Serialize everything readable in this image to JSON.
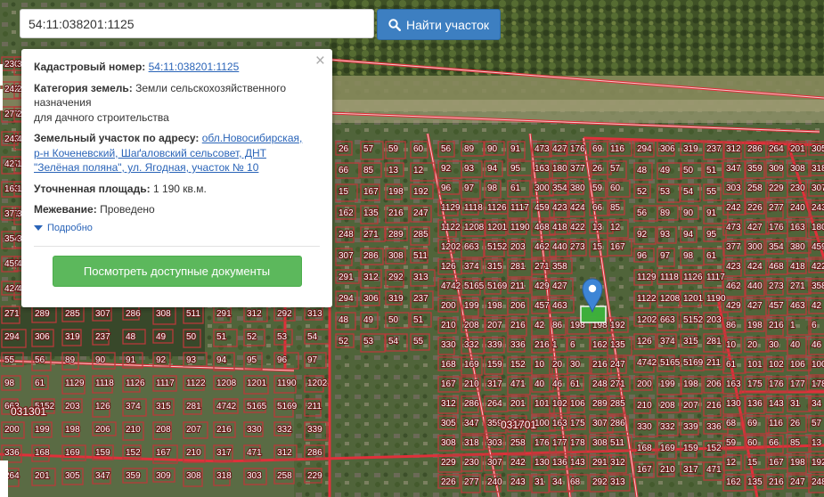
{
  "search": {
    "value": "54:11:038201:1125",
    "button_label": "Найти участок",
    "button_icon": "search-icon"
  },
  "popup": {
    "cadastral_label": "Кадастровый номер:",
    "cadastral_value": "54:11:038201:1125",
    "category_label": "Категория земель:",
    "category_value_1": "Земли сельскохозяйственного",
    "category_value_2": "назначения",
    "category_value_3": "для дачного строительства",
    "address_label": "Земельный участок по адресу:",
    "address_link_1": "обл.Новосибирская,",
    "address_link_2": "р-н Коченевский, Шаґаловский сельсовет, ДНТ",
    "address_link_3": "\"Зелёная поляна\", ул. Ягодная, участок № 10",
    "area_label": "Уточненная площадь:",
    "area_value": "1 190 кв.м.",
    "survey_label": "Межевание:",
    "survey_value": "Проведено",
    "more_label": "Подробно",
    "docs_button": "Посмотреть доступные документы",
    "close_icon": "close-icon"
  },
  "map": {
    "quarter_labels": [
      "031301",
      "031701"
    ],
    "plot_labels": [
      "26",
      "57",
      "59",
      "60",
      "66",
      "85",
      "13",
      "12",
      "15",
      "167",
      "198",
      "192",
      "162",
      "135",
      "216",
      "247",
      "248",
      "271",
      "289",
      "285",
      "307",
      "286",
      "308",
      "511",
      "291",
      "312",
      "292",
      "313",
      "294",
      "306",
      "319",
      "237",
      "48",
      "49",
      "50",
      "51",
      "52",
      "53",
      "54",
      "55",
      "56",
      "89",
      "90",
      "91",
      "92",
      "93",
      "94",
      "95",
      "96",
      "97",
      "98",
      "61",
      "1129",
      "1118",
      "1126",
      "1117",
      "1122",
      "1208",
      "1201",
      "1190",
      "1202",
      "663",
      "5152",
      "203",
      "126",
      "374",
      "315",
      "281",
      "4742",
      "5165",
      "5169",
      "211",
      "200",
      "199",
      "198",
      "206",
      "210",
      "208",
      "207",
      "216",
      "330",
      "332",
      "339",
      "336",
      "168",
      "169",
      "159",
      "152",
      "167",
      "210",
      "317",
      "471",
      "312",
      "286",
      "264",
      "201",
      "305",
      "347",
      "359",
      "309",
      "308",
      "318",
      "303",
      "258",
      "229",
      "230",
      "307",
      "242",
      "226",
      "277",
      "240",
      "243",
      "473",
      "427",
      "176",
      "163",
      "180",
      "377",
      "300",
      "354",
      "380",
      "459",
      "423",
      "424",
      "468",
      "418",
      "422",
      "462",
      "440",
      "273",
      "271",
      "358",
      "429",
      "427",
      "457",
      "463",
      "42",
      "86",
      "198",
      "216",
      "1",
      "6",
      "10",
      "20",
      "30",
      "40",
      "46",
      "61",
      "101",
      "102",
      "106",
      "100",
      "163",
      "175",
      "176",
      "177",
      "178",
      "130",
      "136",
      "143",
      "31",
      "34",
      "68",
      "69",
      "116"
    ],
    "marker_icon": "map-pin-icon",
    "colors": {
      "boundary": "#e0303a",
      "plot": "#b83a3a",
      "marker": "#3d85d6"
    }
  }
}
